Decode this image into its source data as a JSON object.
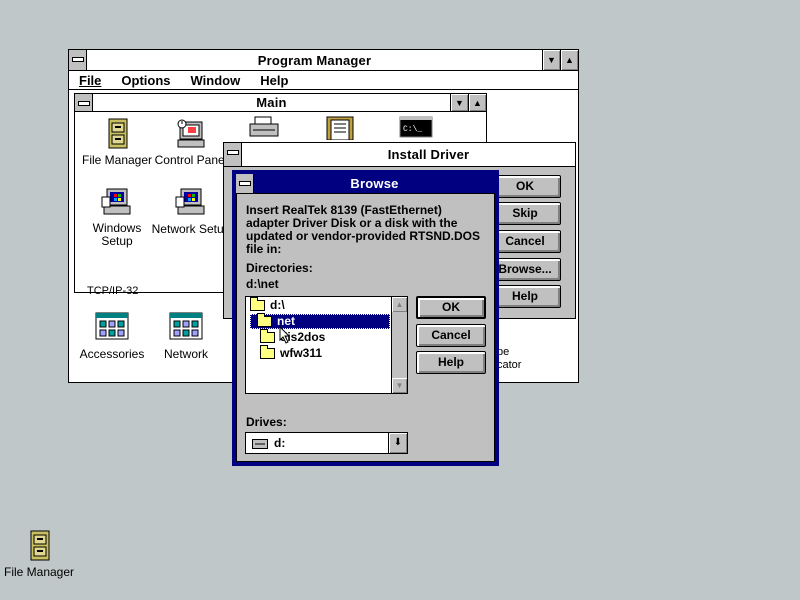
{
  "program_manager": {
    "title": "Program Manager",
    "menu": [
      "File",
      "Options",
      "Window",
      "Help"
    ]
  },
  "main_group": {
    "title": "Main",
    "icons": [
      {
        "label": "File Manager",
        "icon": "file-cabinet-icon"
      },
      {
        "label": "Control Panel",
        "icon": "control-panel-icon"
      },
      {
        "label": "Windows\nSetup",
        "icon": "windows-setup-icon"
      },
      {
        "label": "Network Setup",
        "icon": "network-setup-icon"
      }
    ],
    "partial_label": "TCP/IP-32"
  },
  "background_groups": [
    {
      "label": "Accessories",
      "icon": "program-group-icon"
    },
    {
      "label": "Network",
      "icon": "program-group-icon"
    }
  ],
  "background_partial_label": "pe\ncator",
  "install_driver": {
    "title": "Install Driver",
    "buttons": [
      "OK",
      "Skip",
      "Cancel",
      "Browse...",
      "Help"
    ]
  },
  "browse": {
    "title": "Browse",
    "message": "Insert  RealTek 8139 (FastEthernet) adapter Driver Disk or a disk with the updated or vendor-provided RTSND.DOS file in:",
    "directories_label": "Directories:",
    "current_path": "d:\\net",
    "tree": [
      {
        "name": "d:\\",
        "level": 0,
        "open": true,
        "selected": false
      },
      {
        "name": "net",
        "level": 1,
        "open": true,
        "selected": true
      },
      {
        "name": "dis2dos",
        "level": 2,
        "open": false,
        "selected": false
      },
      {
        "name": "wfw311",
        "level": 2,
        "open": false,
        "selected": false
      }
    ],
    "drives_label": "Drives:",
    "drive_value": "d:",
    "buttons": [
      "OK",
      "Cancel",
      "Help"
    ]
  },
  "desktop_icons": [
    {
      "label": "File Manager",
      "icon": "file-cabinet-icon"
    }
  ],
  "colors": {
    "desktop": "#c0c7c8",
    "active_title": "#000080",
    "selection": "#000080",
    "folder": "#ffff80"
  }
}
